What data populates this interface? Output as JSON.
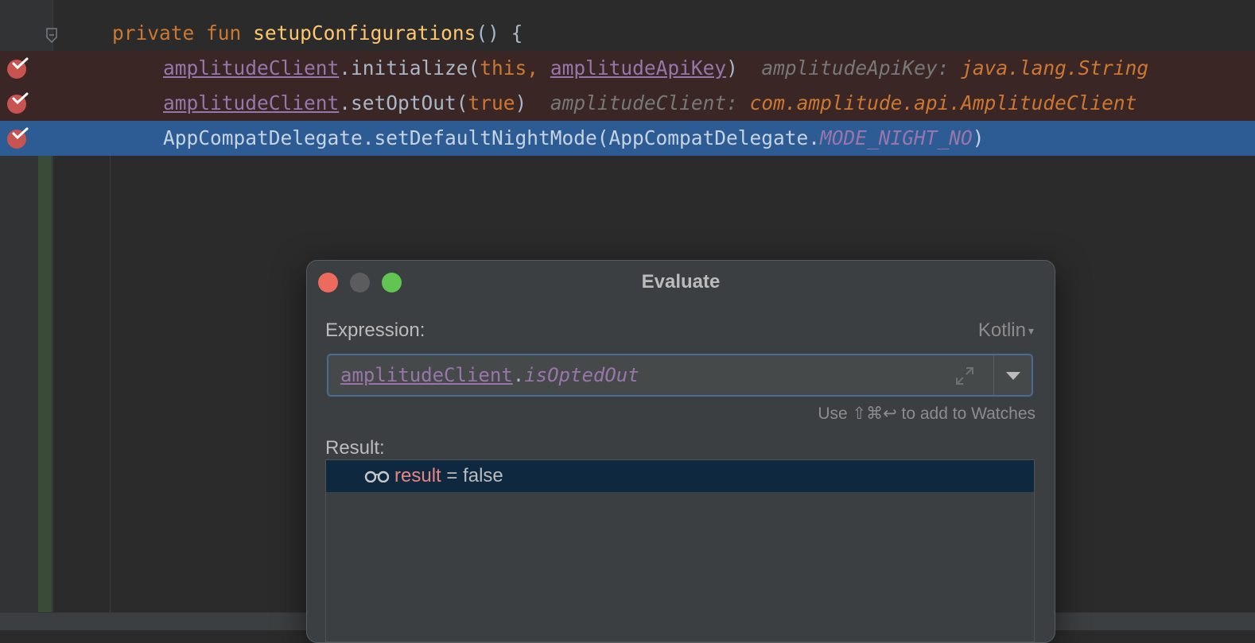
{
  "editor": {
    "lines": [
      {
        "kw1": "private",
        "kw2": "fun",
        "fn": "setupConfigurations",
        "rest": "() {"
      },
      {
        "receiver": "amplitudeClient",
        "call": ".initialize(",
        "arg1": "this,",
        "arg2": "amplitudeApiKey",
        "close": ")",
        "hint_label": "amplitudeApiKey:",
        "hint_type": "java.lang.String"
      },
      {
        "receiver": "amplitudeClient",
        "call": ".setOptOut(",
        "arg1": "true",
        "close": ")",
        "hint_label": "amplitudeClient:",
        "hint_type": "com.amplitude.api.AmplitudeClient"
      },
      {
        "call": "AppCompatDelegate.setDefaultNightMode(AppCompatDelegate.",
        "static_field": "MODE_NIGHT_NO",
        "close": ")"
      }
    ],
    "gutter_icons": [
      "breakpoint-verified-icon",
      "breakpoint-verified-icon",
      "breakpoint-verified-icon"
    ]
  },
  "dialog": {
    "title": "Evaluate",
    "expression_label": "Expression:",
    "language": "Kotlin",
    "expression": {
      "receiver": "amplitudeClient",
      "dot": ".",
      "member": "isOptedOut"
    },
    "hint": "Use ⇧⌘↩ to add to Watches",
    "result_label": "Result:",
    "result": {
      "name": "result",
      "separator": " = ",
      "value": "false"
    },
    "colors": {
      "close": "#ed6a5e",
      "minimize": "#5a5c5e",
      "maximize": "#61c554",
      "focus_border": "#466d94",
      "selected_row": "#0e293f"
    }
  }
}
